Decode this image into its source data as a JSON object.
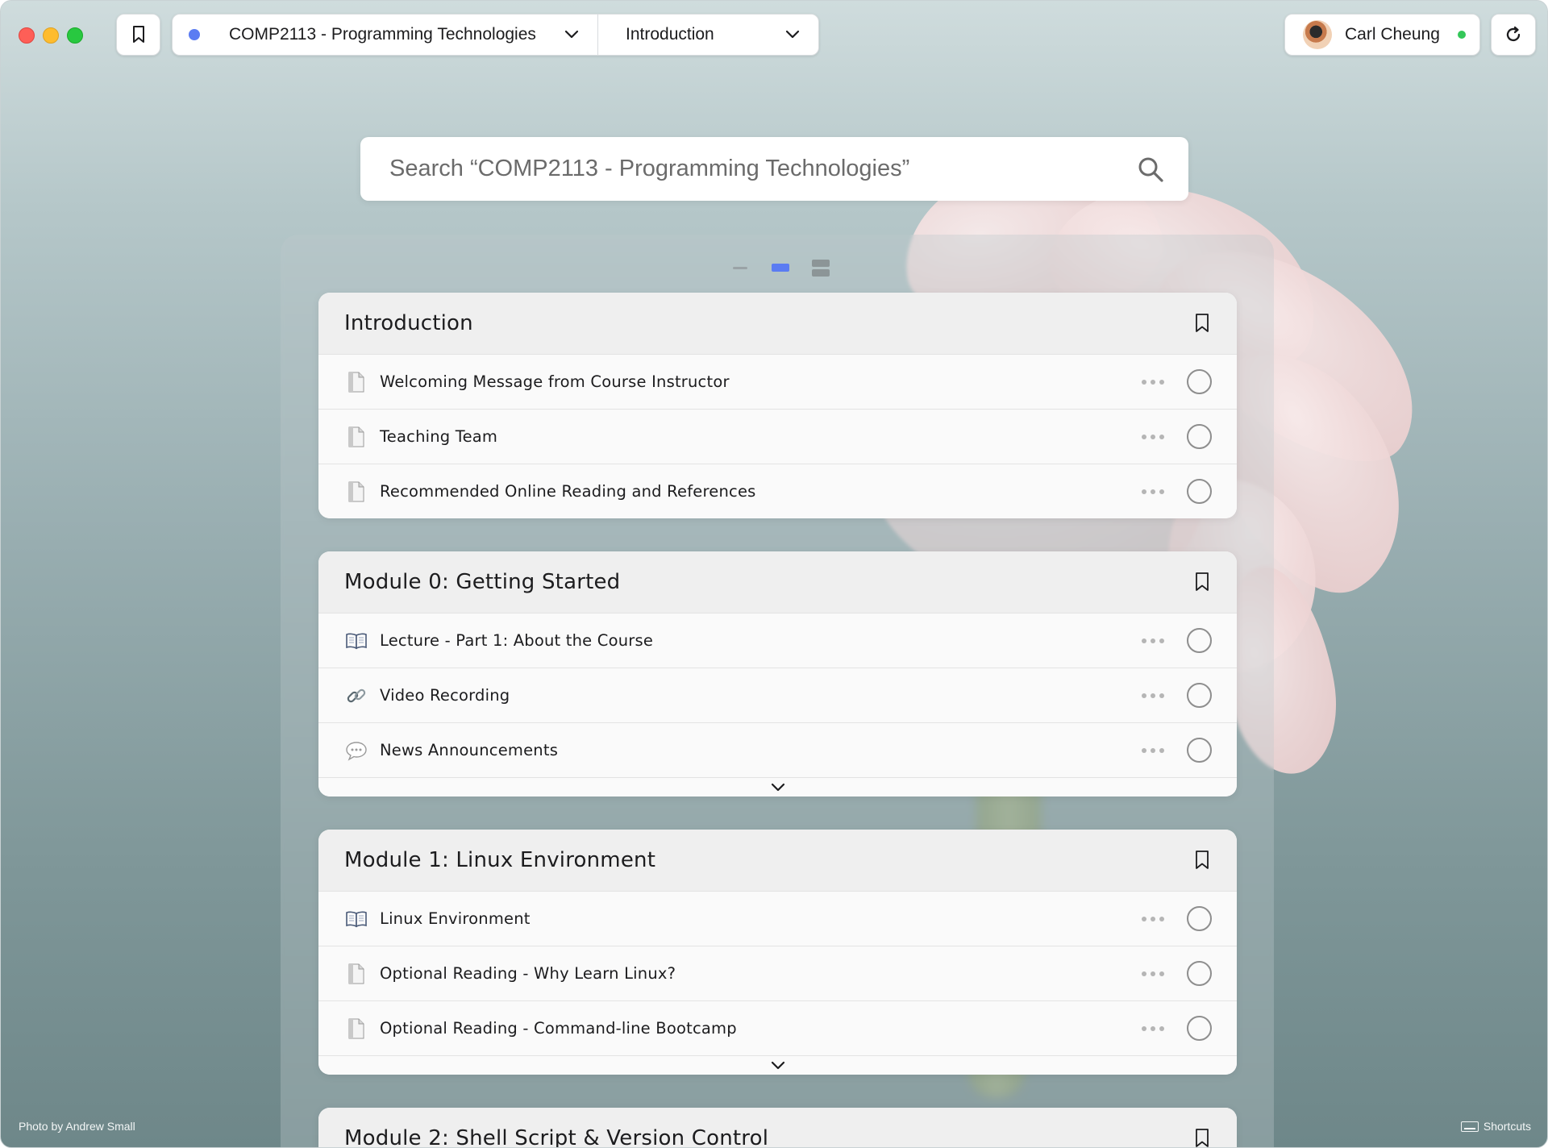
{
  "topbar": {
    "course": "COMP2113 - Programming Technologies",
    "course_color": "#5b7cf2",
    "section": "Introduction",
    "user": "Carl Cheung",
    "status_color": "#34c759"
  },
  "search": {
    "placeholder": "Search “COMP2113 - Programming Technologies”"
  },
  "view_toggle": {
    "active": "cards",
    "accent": "#5b7cf2"
  },
  "modules": [
    {
      "title": "Introduction",
      "items": [
        {
          "label": "Welcoming Message from Course Instructor",
          "icon": "document-icon"
        },
        {
          "label": "Teaching Team",
          "icon": "document-icon"
        },
        {
          "label": "Recommended Online Reading and References",
          "icon": "document-icon"
        }
      ],
      "has_more": false
    },
    {
      "title": "Module 0: Getting Started",
      "items": [
        {
          "label": "Lecture - Part 1: About the Course",
          "icon": "book-icon"
        },
        {
          "label": "Video Recording",
          "icon": "link-icon"
        },
        {
          "label": "News Announcements",
          "icon": "speech-bubble-icon"
        }
      ],
      "has_more": true
    },
    {
      "title": "Module 1: Linux Environment",
      "items": [
        {
          "label": "Linux Environment",
          "icon": "book-icon"
        },
        {
          "label": "Optional Reading - Why Learn Linux?",
          "icon": "document-icon"
        },
        {
          "label": "Optional Reading - Command-line Bootcamp",
          "icon": "document-icon"
        }
      ],
      "has_more": true
    },
    {
      "title": "Module 2: Shell Script & Version Control",
      "items": [],
      "has_more": false
    }
  ],
  "footer": {
    "credit": "Photo by Andrew Small",
    "shortcuts": "Shortcuts"
  }
}
